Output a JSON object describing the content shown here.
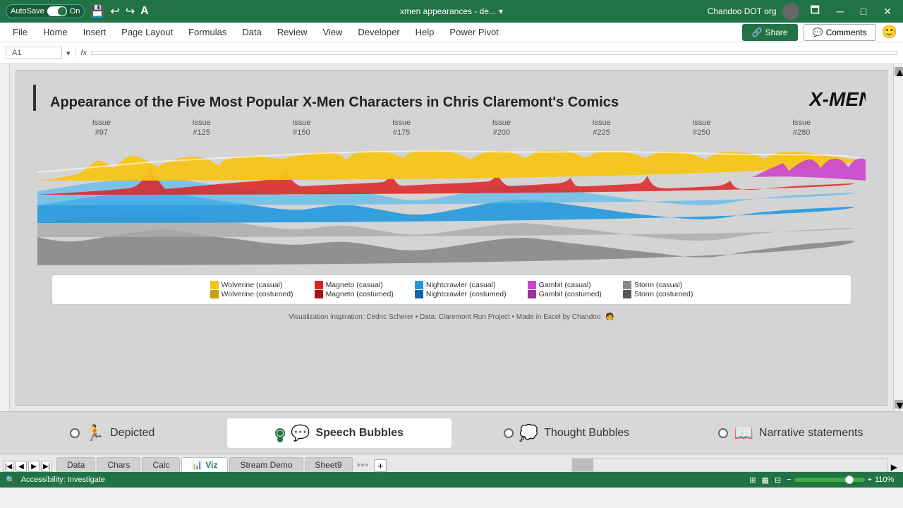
{
  "titlebar": {
    "autosave_label": "AutoSave",
    "autosave_state": "On",
    "title": "xmen appearances - de...",
    "user": "Chandoo DOT org",
    "save_icon": "💾",
    "undo_icon": "↩",
    "redo_icon": "↪"
  },
  "ribbon": {
    "menu_items": [
      "File",
      "Home",
      "Insert",
      "Page Layout",
      "Formulas",
      "Data",
      "Review",
      "View",
      "Developer",
      "Help",
      "Power Pivot"
    ],
    "share_label": "Share",
    "comments_label": "Comments"
  },
  "chart": {
    "title": "Appearance of the Five Most Popular X-Men Characters in Chris Claremont's Comics",
    "issue_labels": [
      {
        "label": "Issue",
        "number": "#97"
      },
      {
        "label": "Issue",
        "number": "#125"
      },
      {
        "label": "Issue",
        "number": "#150"
      },
      {
        "label": "Issue",
        "number": "#175"
      },
      {
        "label": "Issue",
        "number": "#200"
      },
      {
        "label": "Issue",
        "number": "#225"
      },
      {
        "label": "Issue",
        "number": "#250"
      },
      {
        "label": "Issue",
        "number": "#280"
      }
    ],
    "legend": [
      {
        "color": "#F5C518",
        "label1": "Wolverine (casual)",
        "label2": "Wolverine (costumed)"
      },
      {
        "color": "#DD2222",
        "label1": "Magneto (casual)",
        "label2": "Magneto (costumed)"
      },
      {
        "color": "#2299DD",
        "label1": "Nightcrawler (casual)",
        "label2": "Nightcrawler (costumed)"
      },
      {
        "color": "#CC44CC",
        "label1": "Gambit (casual)",
        "label2": "Gambit (costumed)"
      },
      {
        "color": "#888888",
        "label1": "Storm (casual)",
        "label2": "Storm (costumed)"
      }
    ],
    "credit": "Visualization inspiration: Cedric Scherer • Data: Claremont Run Project • Made in Excel by Chandoo"
  },
  "annotations": [
    {
      "id": "depicted",
      "label": "Depicted",
      "icon": "🏃",
      "active": false
    },
    {
      "id": "speech-bubbles",
      "label": "Speech Bubbles",
      "icon": "💬",
      "active": true
    },
    {
      "id": "thought-bubbles",
      "label": "Thought Bubbles",
      "icon": "💭",
      "active": false
    },
    {
      "id": "narrative-statements",
      "label": "Narrative statements",
      "icon": "📖",
      "active": false
    }
  ],
  "tabs": [
    {
      "label": "Data",
      "active": false
    },
    {
      "label": "Chars",
      "active": false
    },
    {
      "label": "Calc",
      "active": false
    },
    {
      "label": "Viz",
      "active": true,
      "icon": "📊"
    },
    {
      "label": "Stream Demo",
      "active": false
    },
    {
      "label": "Sheet9",
      "active": false
    }
  ],
  "status": {
    "accessibility": "Accessibility: Investigate",
    "zoom": "110%"
  }
}
